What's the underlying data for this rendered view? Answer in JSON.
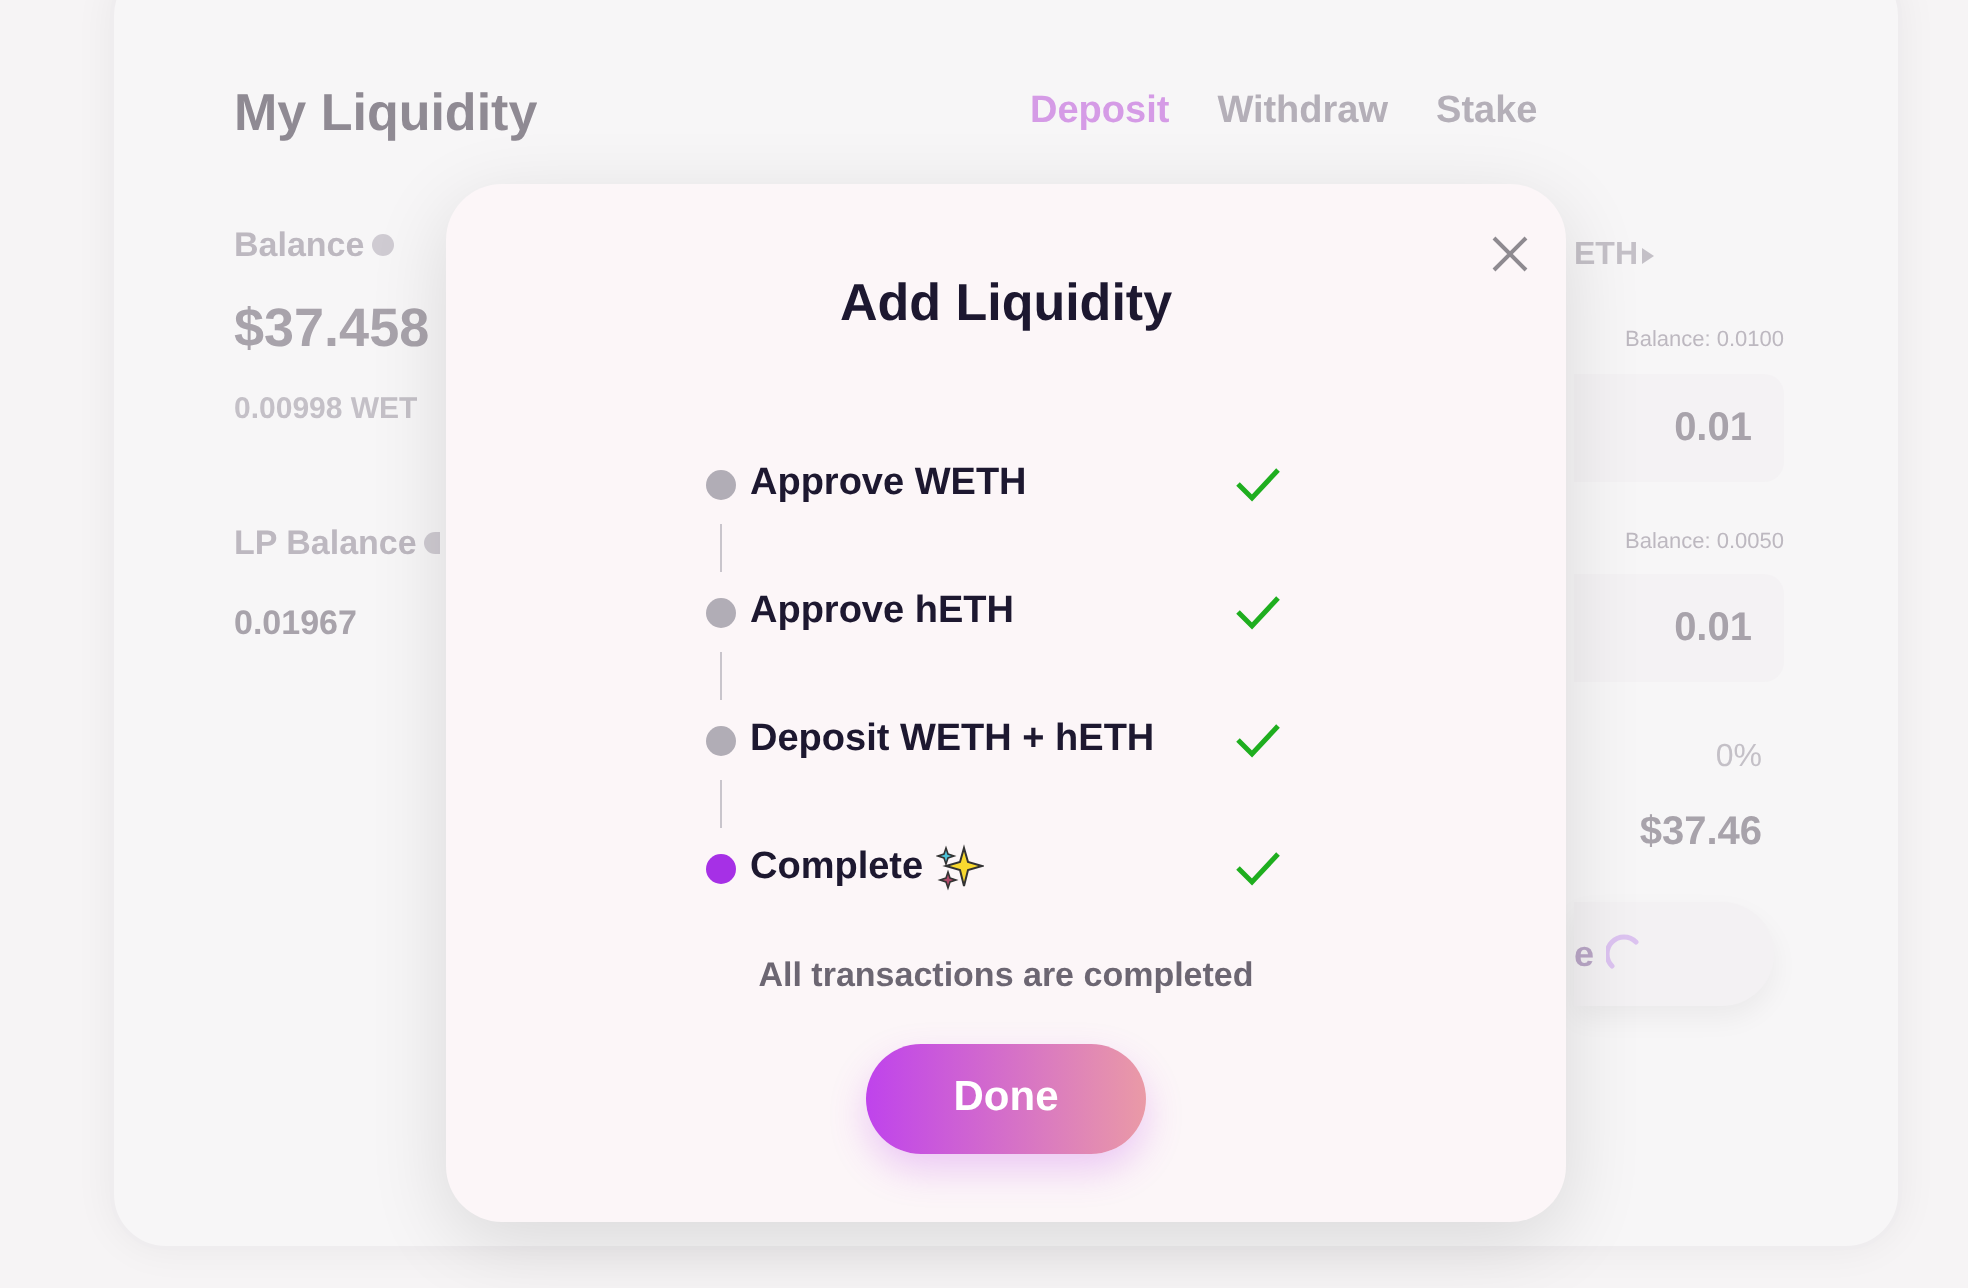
{
  "page": {
    "title": "My Liquidity",
    "tabs": [
      {
        "label": "Deposit",
        "selected": true
      },
      {
        "label": "Withdraw",
        "selected": false
      },
      {
        "label": "Stake",
        "selected": false
      }
    ],
    "balance": {
      "label": "Balance",
      "value": "$37.458",
      "sub": "0.00998 WET"
    },
    "lp_balance": {
      "label": "LP Balance",
      "value": "0.01967"
    },
    "right": {
      "token": "ETH",
      "inputs": [
        {
          "balance": "Balance: 0.0100",
          "value": "0.01"
        },
        {
          "balance": "Balance: 0.0050",
          "value": "0.01"
        }
      ],
      "share": "0%",
      "total": "$37.46",
      "button": {
        "label": "e",
        "loading": true
      }
    }
  },
  "modal": {
    "title": "Add Liquidity",
    "steps": [
      {
        "label": "Approve WETH",
        "active": false,
        "done": true,
        "sparkle": false
      },
      {
        "label": "Approve hETH",
        "active": false,
        "done": true,
        "sparkle": false
      },
      {
        "label": "Deposit WETH + hETH",
        "active": false,
        "done": true,
        "sparkle": false
      },
      {
        "label": "Complete",
        "active": true,
        "done": true,
        "sparkle": true
      }
    ],
    "message": "All transactions are completed",
    "button": "Done"
  }
}
